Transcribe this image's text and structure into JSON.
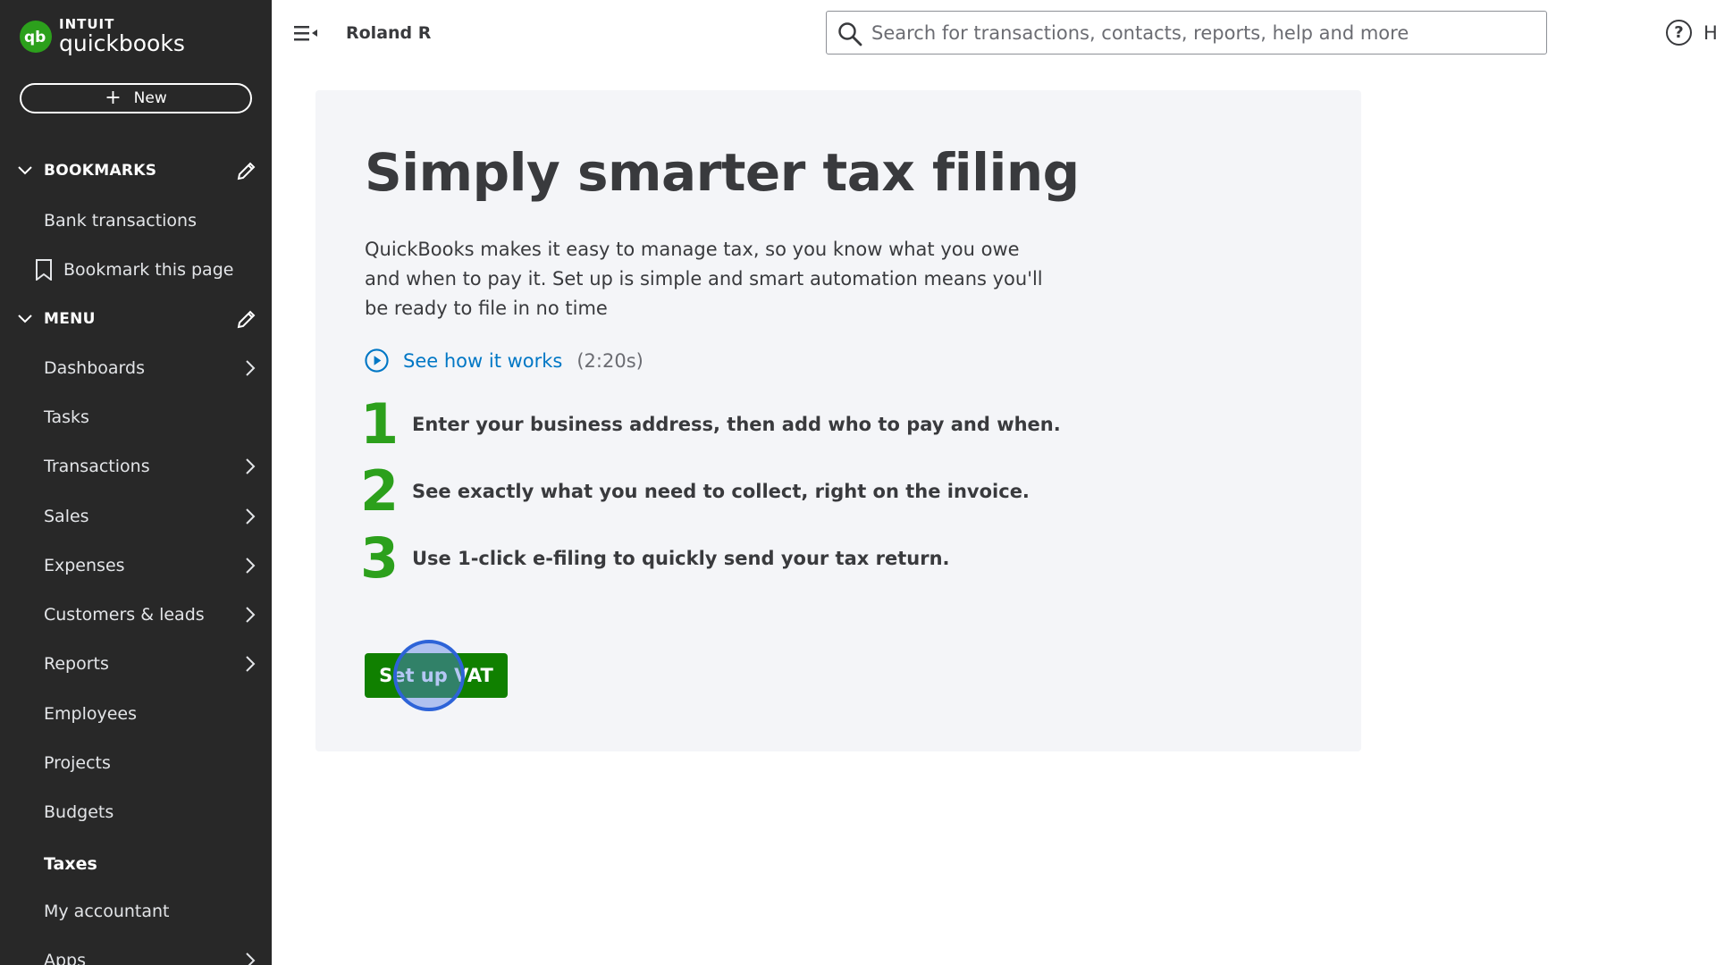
{
  "brand": {
    "intuit": "INTUIT",
    "product": "quickbooks",
    "accent": "#2ca01c"
  },
  "sidebar": {
    "new_label": "New",
    "bookmarks_header": "BOOKMARKS",
    "bookmarks": [
      {
        "label": "Bank transactions"
      },
      {
        "label": "Bookmark this page"
      }
    ],
    "menu_header": "MENU",
    "items": [
      {
        "label": "Dashboards",
        "has_arrow": true
      },
      {
        "label": "Tasks",
        "has_arrow": false
      },
      {
        "label": "Transactions",
        "has_arrow": true
      },
      {
        "label": "Sales",
        "has_arrow": true
      },
      {
        "label": "Expenses",
        "has_arrow": true
      },
      {
        "label": "Customers & leads",
        "has_arrow": true
      },
      {
        "label": "Reports",
        "has_arrow": true
      },
      {
        "label": "Employees",
        "has_arrow": false
      },
      {
        "label": "Projects",
        "has_arrow": false
      },
      {
        "label": "Budgets",
        "has_arrow": false
      },
      {
        "label": "Taxes",
        "has_arrow": false,
        "active": true
      },
      {
        "label": "My accountant",
        "has_arrow": false
      },
      {
        "label": "Apps",
        "has_arrow": true
      }
    ]
  },
  "header": {
    "company": "Roland R",
    "search_placeholder": "Search for transactions, contacts, reports, help and more",
    "help_label": "H"
  },
  "main": {
    "title": "Simply smarter tax filing",
    "description": "QuickBooks makes it easy to manage tax, so you know what you owe and when to pay it. Set up is simple and smart automation means you'll be ready to file in no time",
    "video_link": "See how it works",
    "video_duration": "(2:20s)",
    "steps": [
      {
        "num": "1",
        "text": "Enter your business address, then add who to pay and when."
      },
      {
        "num": "2",
        "text": "See exactly what you need to collect, right on the invoice."
      },
      {
        "num": "3",
        "text": "Use 1-click e-filing to quickly send your tax return."
      }
    ],
    "cta_label": "Set up VAT"
  },
  "colors": {
    "sidebar_bg": "#282828",
    "primary_button": "#108000",
    "link": "#0077c5",
    "step_number": "#2ca01c"
  }
}
